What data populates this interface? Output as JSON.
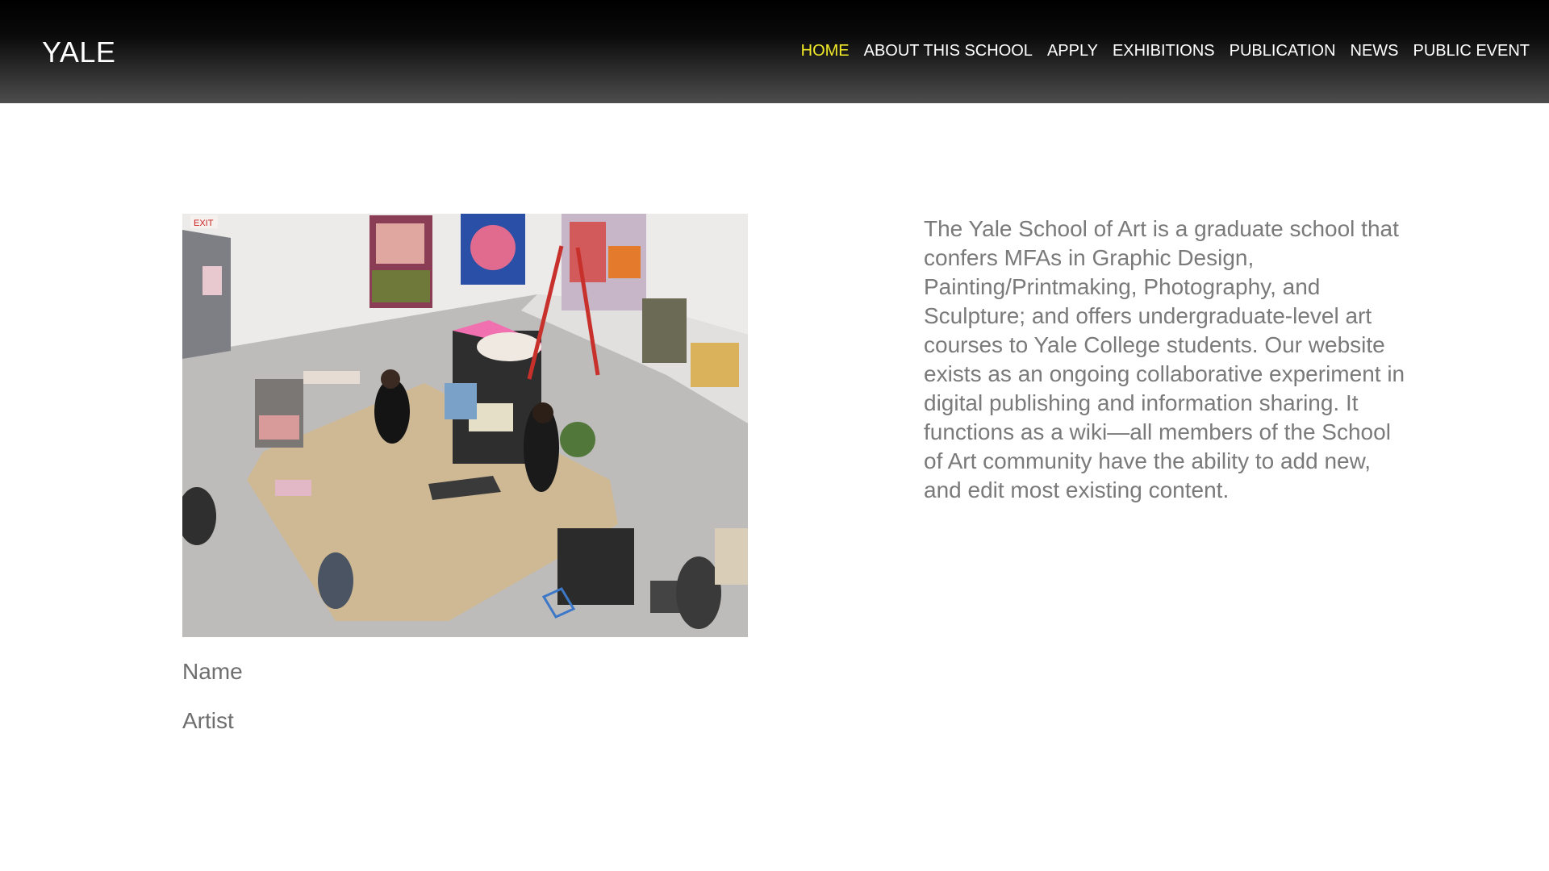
{
  "header": {
    "logo": "YALE",
    "nav": [
      {
        "label": "HOME",
        "active": true
      },
      {
        "label": "ABOUT THIS SCHOOL"
      },
      {
        "label": "APPLY"
      },
      {
        "label": "EXHIBITIONS"
      },
      {
        "label": "PUBLICATION"
      },
      {
        "label": "NEWS"
      },
      {
        "label": "PUBLIC EVENT"
      }
    ],
    "active_color": "#f2ea28"
  },
  "feature": {
    "photo_sign": "EXIT",
    "name_label": "Name",
    "role_label": "Artist"
  },
  "intro": {
    "text": "The Yale School of Art is a graduate school that confers MFAs in Graphic Design, Painting/Printmaking, Photography, and Sculpture; and offers undergraduate-level art courses to Yale College students. Our website exists as an ongoing collaborative experiment in digital publishing and information sharing. It functions as a wiki—all members of the School of Art community have the ability to add new, and edit most existing content."
  }
}
